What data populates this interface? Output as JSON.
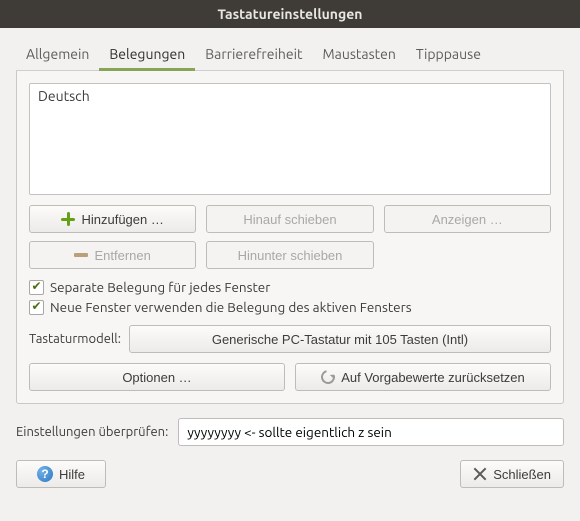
{
  "title": "Tastatureinstellungen",
  "tabs": {
    "general": "Allgemein",
    "layouts": "Belegungen",
    "accessibility": "Barrierefreiheit",
    "mousekeys": "Maustasten",
    "typingbreak": "Tipppause"
  },
  "layouts_list": [
    "Deutsch"
  ],
  "buttons": {
    "add": "Hinzufügen …",
    "remove": "Entfernen",
    "move_up": "Hinauf schieben",
    "move_down": "Hinunter schieben",
    "show": "Anzeigen …",
    "options": "Optionen …",
    "reset": "Auf Vorgabewerte zurücksetzen",
    "help": "Hilfe",
    "close": "Schließen"
  },
  "checkboxes": {
    "separate_per_window": "Separate Belegung für jedes Fenster",
    "new_windows_inherit": "Neue Fenster verwenden die Belegung des aktiven Fensters"
  },
  "keyboard_model": {
    "label": "Tastaturmodell:",
    "value": "Generische PC-Tastatur mit 105 Tasten (Intl)"
  },
  "test": {
    "label": "Einstellungen überprüfen:",
    "value": "yyyyyyyy <- sollte eigentlich z sein"
  }
}
